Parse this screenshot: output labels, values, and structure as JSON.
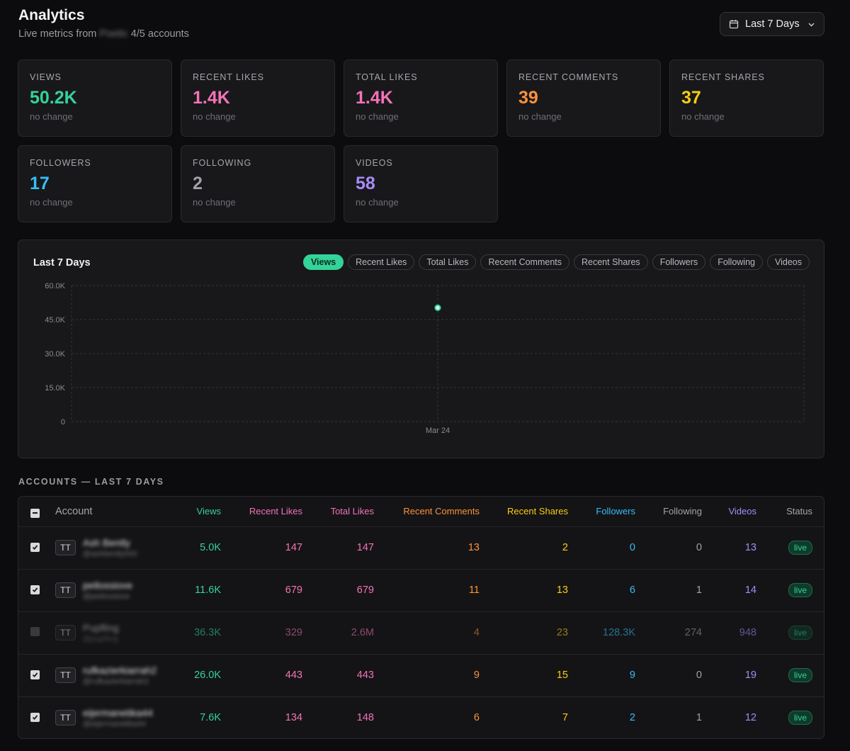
{
  "header": {
    "title": "Analytics",
    "subtitle_prefix": "Live metrics from",
    "subtitle_blurred": "Poetic",
    "subtitle_count": "4/5 accounts"
  },
  "date_range": {
    "label": "Last 7 Days"
  },
  "colors": {
    "views": "#34d399",
    "recent_likes": "#f472b6",
    "total_likes": "#f472b6",
    "recent_comments": "#fb923c",
    "recent_shares": "#facc15",
    "followers": "#38bdf8",
    "following": "#a1a1aa",
    "videos": "#a78bfa"
  },
  "stats": [
    {
      "label": "VIEWS",
      "value": "50.2K",
      "delta": "no change",
      "color": "#34d399"
    },
    {
      "label": "RECENT LIKES",
      "value": "1.4K",
      "delta": "no change",
      "color": "#f472b6"
    },
    {
      "label": "TOTAL LIKES",
      "value": "1.4K",
      "delta": "no change",
      "color": "#f472b6"
    },
    {
      "label": "RECENT COMMENTS",
      "value": "39",
      "delta": "no change",
      "color": "#fb923c"
    },
    {
      "label": "RECENT SHARES",
      "value": "37",
      "delta": "no change",
      "color": "#facc15"
    },
    {
      "label": "FOLLOWERS",
      "value": "17",
      "delta": "no change",
      "color": "#38bdf8"
    },
    {
      "label": "FOLLOWING",
      "value": "2",
      "delta": "no change",
      "color": "#a1a1aa"
    },
    {
      "label": "VIDEOS",
      "value": "58",
      "delta": "no change",
      "color": "#a78bfa"
    }
  ],
  "chart_panel": {
    "title": "Last 7 Days",
    "metric_tabs": [
      "Views",
      "Recent Likes",
      "Total Likes",
      "Recent Comments",
      "Recent Shares",
      "Followers",
      "Following",
      "Videos"
    ],
    "active_tab": "Views"
  },
  "chart_data": {
    "type": "line",
    "x": [
      "Mar 24"
    ],
    "series": [
      {
        "values": [
          50200
        ]
      }
    ],
    "ylim": [
      0,
      60000
    ],
    "yticks": [
      "0",
      "15.0K",
      "30.0K",
      "45.0K",
      "60.0K"
    ],
    "xlabel": "",
    "ylabel": "",
    "grid": true,
    "color": "#34d399"
  },
  "accounts_section": {
    "label": "ACCOUNTS — LAST 7 DAYS",
    "columns": [
      "Account",
      "Views",
      "Recent Likes",
      "Total Likes",
      "Recent Comments",
      "Recent Shares",
      "Followers",
      "Following",
      "Videos",
      "Status"
    ],
    "rows": [
      {
        "checked": true,
        "platform": "TT",
        "name": "Ash Bently",
        "handle": "@ashbently000",
        "views": "5.0K",
        "recent_likes": "147",
        "total_likes": "147",
        "recent_comments": "13",
        "recent_shares": "2",
        "followers": "0",
        "following": "0",
        "videos": "13",
        "status": "live"
      },
      {
        "checked": true,
        "platform": "TT",
        "name": "petlossiove",
        "handle": "@petlossiove",
        "views": "11.6K",
        "recent_likes": "679",
        "total_likes": "679",
        "recent_comments": "11",
        "recent_shares": "13",
        "followers": "6",
        "following": "1",
        "videos": "14",
        "status": "live"
      },
      {
        "checked": false,
        "platform": "TT",
        "name": "Pupfling",
        "handle": "@pupfling",
        "views": "36.3K",
        "recent_likes": "329",
        "total_likes": "2.6M",
        "recent_comments": "4",
        "recent_shares": "23",
        "followers": "128.3K",
        "following": "274",
        "videos": "948",
        "status": "live"
      },
      {
        "checked": true,
        "platform": "TT",
        "name": "rufkazierkiarrah2",
        "handle": "@rufkazierkiarrah2",
        "views": "26.0K",
        "recent_likes": "443",
        "total_likes": "443",
        "recent_comments": "9",
        "recent_shares": "15",
        "followers": "9",
        "following": "0",
        "videos": "19",
        "status": "live"
      },
      {
        "checked": true,
        "platform": "TT",
        "name": "eijermanetika44",
        "handle": "@eijermanetika44",
        "views": "7.6K",
        "recent_likes": "134",
        "total_likes": "148",
        "recent_comments": "6",
        "recent_shares": "7",
        "followers": "2",
        "following": "1",
        "videos": "12",
        "status": "live"
      }
    ]
  }
}
